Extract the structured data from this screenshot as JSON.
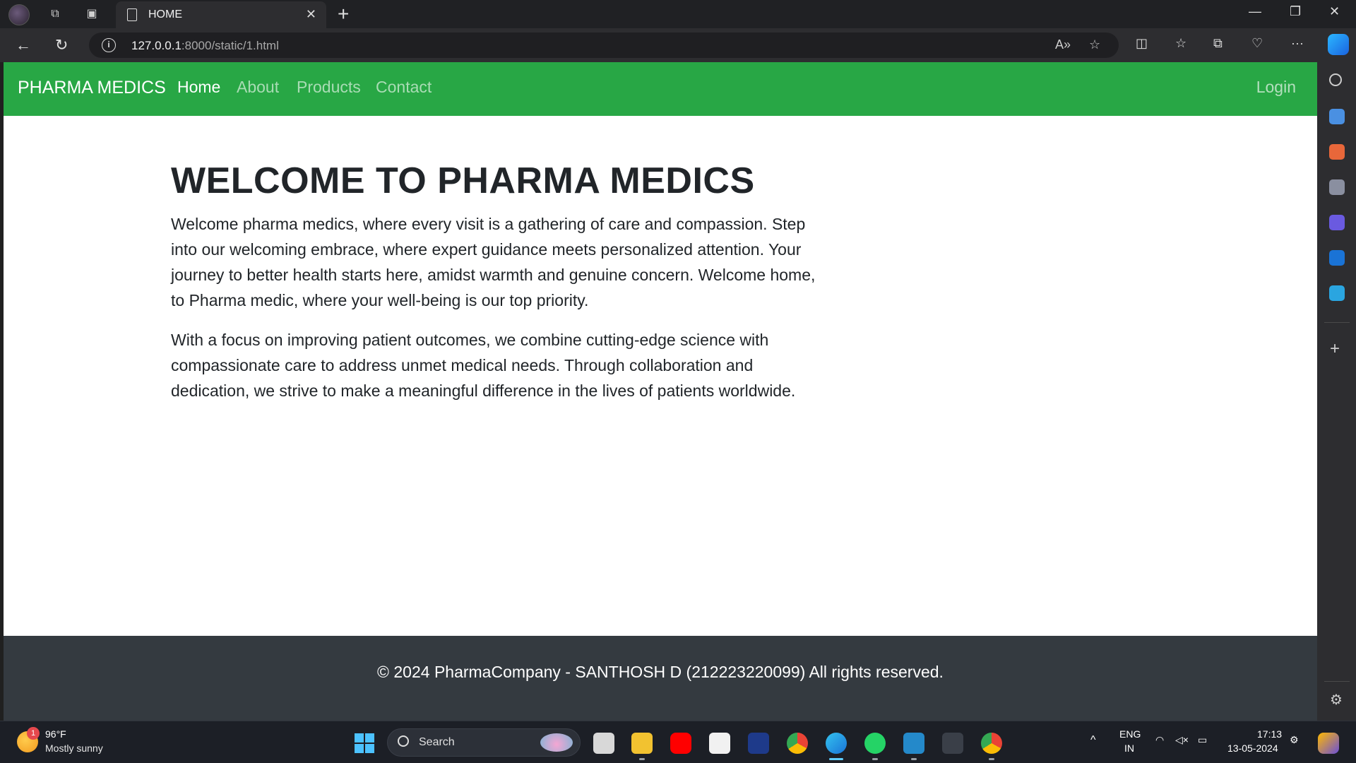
{
  "browser": {
    "tab_title": "HOME",
    "url_host": "127.0.0.1",
    "url_rest": ":8000/static/1.html"
  },
  "site": {
    "brand": "PHARMA MEDICS",
    "nav": [
      "Home",
      "About",
      "Products",
      "Contact"
    ],
    "active_nav": "Home",
    "login": "Login",
    "heading": "WELCOME TO PHARMA MEDICS",
    "paragraphs": [
      "Welcome pharma medics, where every visit is a gathering of care and compassion. Step into our welcoming embrace, where expert guidance meets personalized attention. Your journey to better health starts here, amidst warmth and genuine concern. Welcome home, to Pharma medic, where your well-being is our top priority.",
      "With a focus on improving patient outcomes, we combine cutting-edge science with compassionate care to address unmet medical needs. Through collaboration and dedication, we strive to make a meaningful difference in the lives of patients worldwide."
    ],
    "footer": "© 2024 PharmaCompany - SANTHOSH D (212223220099) All rights reserved.",
    "colors": {
      "navbar": "#28a745",
      "footer": "#343a40"
    }
  },
  "taskbar": {
    "weather_badge": "1",
    "temp": "96°F",
    "weather": "Mostly sunny",
    "search": "Search",
    "lang1": "ENG",
    "lang2": "IN",
    "time": "17:13",
    "date": "13-05-2024"
  }
}
